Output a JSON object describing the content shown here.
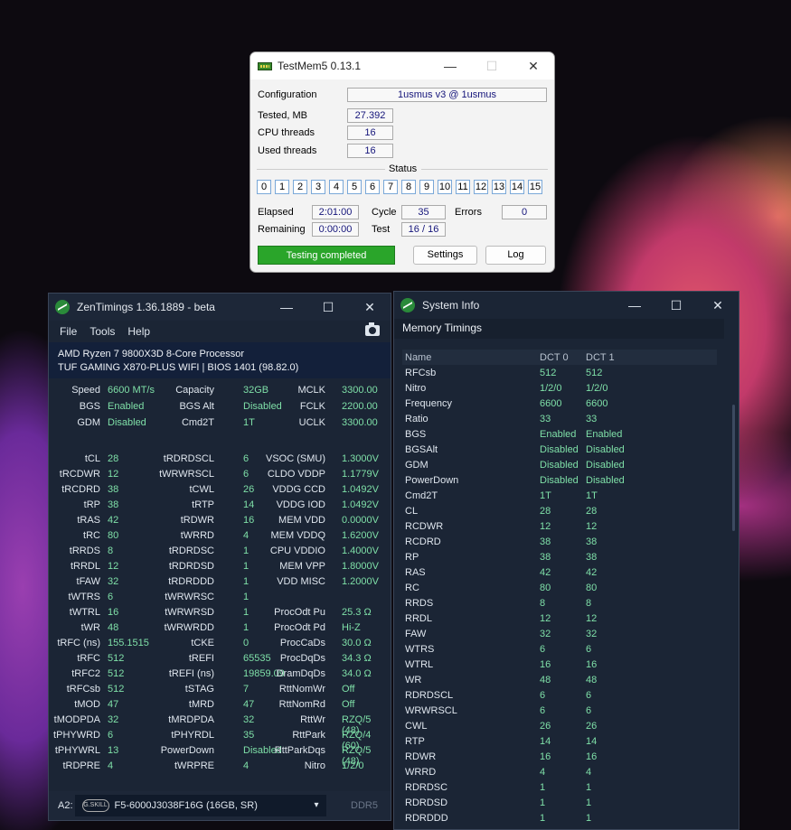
{
  "testmem": {
    "title": "TestMem5  0.13.1",
    "configuration_label": "Configuration",
    "configuration_value": "1usmus v3 @ 1usmus",
    "tested_label": "Tested, MB",
    "tested_value": "27.392",
    "cpu_threads_label": "CPU threads",
    "cpu_threads_value": "16",
    "used_threads_label": "Used threads",
    "used_threads_value": "16",
    "status_label": "Status",
    "status_cells": [
      "0",
      "1",
      "2",
      "3",
      "4",
      "5",
      "6",
      "7",
      "8",
      "9",
      "10",
      "11",
      "12",
      "13",
      "14",
      "15"
    ],
    "elapsed_label": "Elapsed",
    "elapsed_value": "2:01:00",
    "remaining_label": "Remaining",
    "remaining_value": "0:00:00",
    "cycle_label": "Cycle",
    "cycle_value": "35",
    "test_label": "Test",
    "test_value": "16 / 16",
    "errors_label": "Errors",
    "errors_value": "0",
    "progress_text": "Testing completed",
    "settings_button": "Settings",
    "log_button": "Log"
  },
  "zentimings": {
    "title": "ZenTimings 1.36.1889 - beta",
    "menu": [
      "File",
      "Tools",
      "Help"
    ],
    "cpu": "AMD Ryzen 7 9800X3D 8-Core Processor",
    "board": "TUF GAMING X870-PLUS WIFI | BIOS 1401 (98.82.0)",
    "top_rows": [
      [
        "Speed",
        "6600 MT/s",
        "Capacity",
        "32GB",
        "MCLK",
        "3300.00"
      ],
      [
        "BGS",
        "Enabled",
        "BGS Alt",
        "Disabled",
        "FCLK",
        "2200.00"
      ],
      [
        "GDM",
        "Disabled",
        "Cmd2T",
        "1T",
        "UCLK",
        "3300.00"
      ]
    ],
    "rows": [
      [
        "tCL",
        "28",
        "tRDRDSCL",
        "6",
        "VSOC (SMU)",
        "1.3000V"
      ],
      [
        "tRCDWR",
        "12",
        "tWRWRSCL",
        "6",
        "CLDO VDDP",
        "1.1779V"
      ],
      [
        "tRCDRD",
        "38",
        "tCWL",
        "26",
        "VDDG CCD",
        "1.0492V"
      ],
      [
        "tRP",
        "38",
        "tRTP",
        "14",
        "VDDG IOD",
        "1.0492V"
      ],
      [
        "tRAS",
        "42",
        "tRDWR",
        "16",
        "MEM VDD",
        "0.0000V"
      ],
      [
        "tRC",
        "80",
        "tWRRD",
        "4",
        "MEM VDDQ",
        "1.6200V"
      ],
      [
        "tRRDS",
        "8",
        "tRDRDSC",
        "1",
        "CPU VDDIO",
        "1.4000V"
      ],
      [
        "tRRDL",
        "12",
        "tRDRDSD",
        "1",
        "MEM VPP",
        "1.8000V"
      ],
      [
        "tFAW",
        "32",
        "tRDRDDD",
        "1",
        "VDD MISC",
        "1.2000V"
      ],
      [
        "tWTRS",
        "6",
        "tWRWRSC",
        "1",
        "",
        ""
      ],
      [
        "tWTRL",
        "16",
        "tWRWRSD",
        "1",
        "ProcOdt Pu",
        "25.3 Ω"
      ],
      [
        "tWR",
        "48",
        "tWRWRDD",
        "1",
        "ProcOdt Pd",
        "Hi-Z"
      ],
      [
        "tRFC (ns)",
        "155.1515",
        "tCKE",
        "0",
        "ProcCaDs",
        "30.0 Ω"
      ],
      [
        "tRFC",
        "512",
        "tREFI",
        "65535",
        "ProcDqDs",
        "34.3 Ω"
      ],
      [
        "tRFC2",
        "512",
        "tREFI (ns)",
        "19859.09",
        "DramDqDs",
        "34.0 Ω"
      ],
      [
        "tRFCsb",
        "512",
        "tSTAG",
        "7",
        "RttNomWr",
        "Off"
      ],
      [
        "tMOD",
        "47",
        "tMRD",
        "47",
        "RttNomRd",
        "Off"
      ],
      [
        "tMODPDA",
        "32",
        "tMRDPDA",
        "32",
        "RttWr",
        "RZQ/5 (48)"
      ],
      [
        "tPHYWRD",
        "6",
        "tPHYRDL",
        "35",
        "RttPark",
        "RZQ/4 (60)"
      ],
      [
        "tPHYWRL",
        "13",
        "PowerDown",
        "Disabled",
        "RttParkDqs",
        "RZQ/5 (48)"
      ],
      [
        "tRDPRE",
        "4",
        "tWRPRE",
        "4",
        "Nitro",
        "1/2/0"
      ]
    ],
    "slot_label": "A2:",
    "gskill_logo": "G.SKILL",
    "module": "F5-6000J3038F16G (16GB, SR)",
    "ddr": "DDR5"
  },
  "sysinfo": {
    "title": "System Info",
    "tab": "Memory Timings",
    "columns": [
      "Name",
      "DCT 0",
      "DCT 1"
    ],
    "rows": [
      [
        "RFCsb",
        "512",
        "512"
      ],
      [
        "Nitro",
        "1/2/0",
        "1/2/0"
      ],
      [
        "Frequency",
        "6600",
        "6600"
      ],
      [
        "Ratio",
        "33",
        "33"
      ],
      [
        "BGS",
        "Enabled",
        "Enabled"
      ],
      [
        "BGSAlt",
        "Disabled",
        "Disabled"
      ],
      [
        "GDM",
        "Disabled",
        "Disabled"
      ],
      [
        "PowerDown",
        "Disabled",
        "Disabled"
      ],
      [
        "Cmd2T",
        "1T",
        "1T"
      ],
      [
        "CL",
        "28",
        "28"
      ],
      [
        "RCDWR",
        "12",
        "12"
      ],
      [
        "RCDRD",
        "38",
        "38"
      ],
      [
        "RP",
        "38",
        "38"
      ],
      [
        "RAS",
        "42",
        "42"
      ],
      [
        "RC",
        "80",
        "80"
      ],
      [
        "RRDS",
        "8",
        "8"
      ],
      [
        "RRDL",
        "12",
        "12"
      ],
      [
        "FAW",
        "32",
        "32"
      ],
      [
        "WTRS",
        "6",
        "6"
      ],
      [
        "WTRL",
        "16",
        "16"
      ],
      [
        "WR",
        "48",
        "48"
      ],
      [
        "RDRDSCL",
        "6",
        "6"
      ],
      [
        "WRWRSCL",
        "6",
        "6"
      ],
      [
        "CWL",
        "26",
        "26"
      ],
      [
        "RTP",
        "14",
        "14"
      ],
      [
        "RDWR",
        "16",
        "16"
      ],
      [
        "WRRD",
        "4",
        "4"
      ],
      [
        "RDRDSC",
        "1",
        "1"
      ],
      [
        "RDRDSD",
        "1",
        "1"
      ],
      [
        "RDRDDD",
        "1",
        "1"
      ]
    ]
  },
  "window_controls": {
    "minimize": "—",
    "maximize": "☐",
    "close": "✕"
  }
}
